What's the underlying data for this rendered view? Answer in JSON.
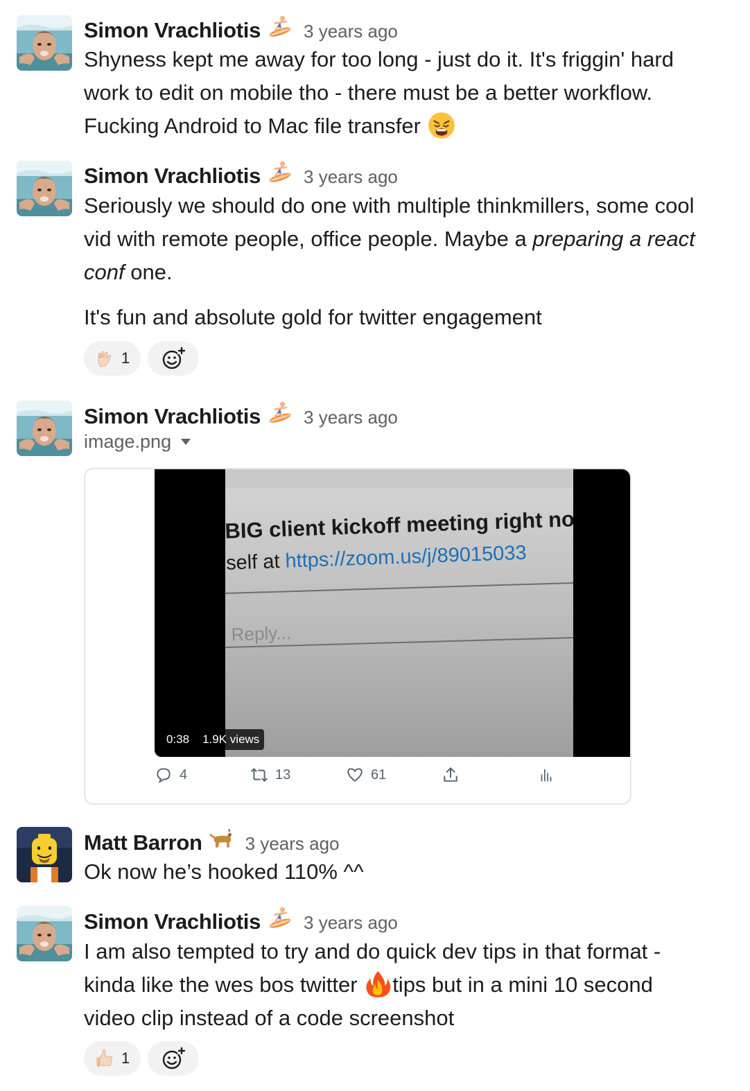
{
  "messages": [
    {
      "author": "Simon Vrachliotis",
      "status_emoji": "surfer-emoji",
      "time": "3 years ago",
      "line1": "Shyness kept me away for too long - just do it. It's friggin' hard",
      "line2": "work to edit on mobile tho - there must be a better workflow.",
      "line3": "Fucking Android to Mac file transfer",
      "inline_emoji": "weary-face-emoji"
    },
    {
      "author": "Simon Vrachliotis",
      "status_emoji": "surfer-emoji",
      "time": "3 years ago",
      "text_a": "Seriously we should do one with multiple thinkmillers, some cool",
      "text_b": "vid with remote people, office people. Maybe a ",
      "italic_a": "preparing a react",
      "italic_b": "conf",
      "text_c": " one.",
      "paragraph2": "It's fun and absolute gold for twitter engagement",
      "reaction": {
        "emoji": "ok-hand-emoji",
        "count": "1"
      }
    },
    {
      "author": "Simon Vrachliotis",
      "status_emoji": "surfer-emoji",
      "time": "3 years ago",
      "filename": "image.png",
      "tweet": {
        "screen_line1": "BIG client kickoff meeting right no",
        "screen_line2_prefix": "self at ",
        "screen_line2_link": "https://zoom.us/j/89015033",
        "screen_reply": "Reply...",
        "duration": "0:38",
        "views": "1.9K views",
        "replies": "4",
        "retweets": "13",
        "likes": "61"
      }
    },
    {
      "author": "Matt Barron",
      "status_emoji": "dog-emoji",
      "time": "3 years ago",
      "text": "Ok now he’s hooked 110% ^^"
    },
    {
      "author": "Simon Vrachliotis",
      "status_emoji": "surfer-emoji",
      "time": "3 years ago",
      "line1": "I am also tempted to try and do quick dev tips in that format -",
      "line2a": "kinda like the wes bos twitter ",
      "line2b": "tips but in a mini 10 second",
      "line3": "video clip instead of a code screenshot",
      "inline_emoji": "fire-emoji",
      "reaction": {
        "emoji": "thumbs-up-emoji",
        "count": "1"
      }
    }
  ],
  "colors": {
    "text": "#1d1c1d",
    "muted": "#616061",
    "reaction_bg": "#f2f2f2",
    "link": "#1d6fb8"
  }
}
